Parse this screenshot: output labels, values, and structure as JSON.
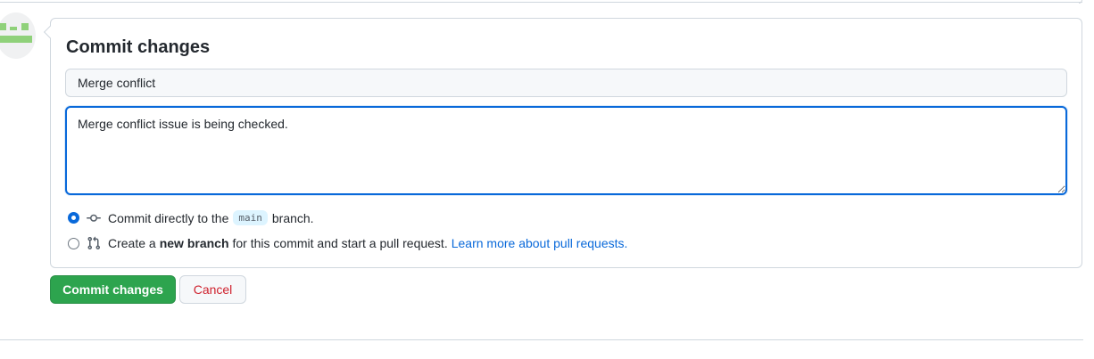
{
  "commit": {
    "heading": "Commit changes",
    "summary_value": "Merge conflict",
    "description_value": "Merge conflict issue is being checked.",
    "options": {
      "direct": {
        "prefix": "Commit directly to the",
        "branch": "main",
        "suffix": "branch.",
        "selected": true
      },
      "new_branch": {
        "prefix": "Create a",
        "bold": "new branch",
        "suffix": "for this commit and start a pull request.",
        "link": "Learn more about pull requests.",
        "selected": false
      }
    },
    "buttons": {
      "commit": "Commit changes",
      "cancel": "Cancel"
    }
  },
  "colors": {
    "primary": "#2da44e",
    "danger": "#cf222e",
    "accent": "#0969da",
    "border": "#d0d7de"
  },
  "icons": {
    "avatar": "identicon-avatar",
    "commit": "git-commit-icon",
    "pull_request": "git-pull-request-icon"
  }
}
